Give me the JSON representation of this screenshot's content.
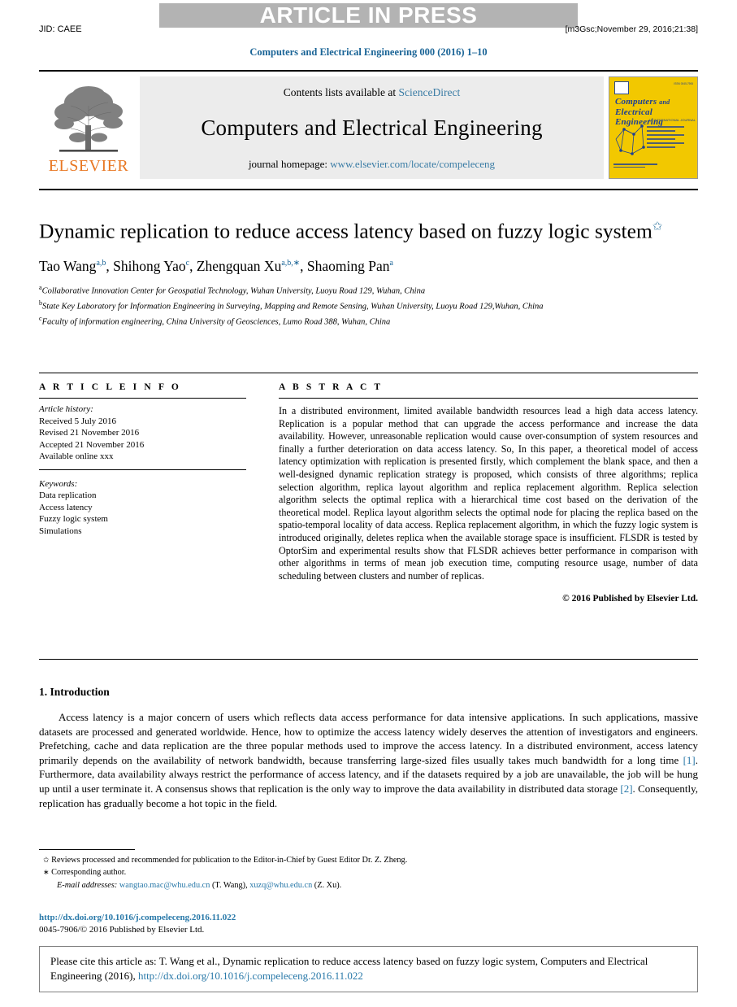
{
  "banner": {
    "text": "ARTICLE IN PRESS"
  },
  "header": {
    "jid": "JID: CAEE",
    "stamp": "[m3Gsc;November 29, 2016;21:38]",
    "running_title": "Computers and Electrical Engineering 000 (2016) 1–10"
  },
  "masthead": {
    "contents_prefix": "Contents lists available at ",
    "sciencedirect": "ScienceDirect",
    "journal_name": "Computers and Electrical Engineering",
    "homepage_prefix": "journal homepage: ",
    "homepage_url": "www.elsevier.com/locate/compeleceng",
    "publisher": "ELSEVIER",
    "cover": {
      "title_line1": "Computers",
      "title_line1b": "and",
      "title_line2": "Electrical Engineering",
      "sub": "AN INTERNATIONAL JOURNAL",
      "corner": "ISSN 0045-7906"
    }
  },
  "article": {
    "title": "Dynamic replication to reduce access latency based on fuzzy logic system",
    "title_star": "✩",
    "authors": [
      {
        "name": "Tao Wang",
        "sup": "a,b"
      },
      {
        "name": "Shihong Yao",
        "sup": "c"
      },
      {
        "name": "Zhengquan Xu",
        "sup": "a,b,∗"
      },
      {
        "name": "Shaoming Pan",
        "sup": "a"
      }
    ],
    "affiliations": [
      {
        "mark": "a",
        "text": "Collaborative Innovation Center for Geospatial Technology, Wuhan University, Luoyu Road 129, Wuhan, China"
      },
      {
        "mark": "b",
        "text": "State Key Laboratory for Information Engineering in Surveying, Mapping and Remote Sensing, Wuhan University, Luoyu Road 129,Wuhan, China"
      },
      {
        "mark": "c",
        "text": "Faculty of information engineering, China University of Geosciences, Lumo Road 388, Wuhan, China"
      }
    ]
  },
  "info": {
    "heading": "A R T I C L E   I N F O",
    "history_label": "Article history:",
    "history": [
      "Received 5 July 2016",
      "Revised 21 November 2016",
      "Accepted 21 November 2016",
      "Available online xxx"
    ],
    "keywords_label": "Keywords:",
    "keywords": [
      "Data replication",
      "Access latency",
      "Fuzzy logic system",
      "Simulations"
    ]
  },
  "abstract": {
    "heading": "A B S T R A C T",
    "text": "In a distributed environment, limited available bandwidth resources lead a high data access latency. Replication is a popular method that can upgrade the access performance and increase the data availability. However, unreasonable replication would cause over-consumption of system resources and finally a further deterioration on data access latency. So, In this paper, a theoretical model of access latency optimization with replication is presented firstly, which complement the blank space, and then a well-designed dynamic replication strategy is proposed, which consists of three algorithms; replica selection algorithm, replica layout algorithm and replica replacement algorithm. Replica selection algorithm selects the optimal replica with a hierarchical time cost based on the derivation of the theoretical model. Replica layout algorithm selects the optimal node for placing the replica based on the spatio-temporal locality of data access. Replica replacement algorithm, in which the fuzzy logic system is introduced originally, deletes replica when the available storage space is insufficient. FLSDR is tested by OptorSim and experimental results show that FLSDR achieves better performance in comparison with other algorithms in terms of mean job execution time, computing resource usage, number of data scheduling between clusters and number of replicas.",
    "copyright": "© 2016 Published by Elsevier Ltd."
  },
  "introduction": {
    "heading": "1. Introduction",
    "para_part1": "Access latency is a major concern of users which reflects data access performance for data intensive applications. In such applications, massive datasets are processed and generated worldwide. Hence, how to optimize the access latency widely deserves the attention of investigators and engineers. Prefetching, cache and data replication are the three popular methods used to improve the access latency. In a distributed environment, access latency primarily depends on the availability of network bandwidth, because transferring large-sized files usually takes much bandwidth for a long time ",
    "ref1": "[1]",
    "para_part2": ". Furthermore, data availability always restrict the performance of access latency, and if the datasets required by a job are unavailable, the job will be hung up until a user terminate it. A consensus shows that replication is the only way to improve the data availability in distributed data storage ",
    "ref2": "[2]",
    "para_part3": ". Consequently, replication has gradually become a hot topic in the field."
  },
  "footnotes": {
    "star_mark": "✩",
    "star_text": "Reviews processed and recommended for publication to the Editor-in-Chief by Guest Editor Dr. Z. Zheng.",
    "corr_mark": "∗",
    "corr_text": "Corresponding author.",
    "email_label": "E-mail addresses:",
    "email1": "wangtao.mac@whu.edu.cn",
    "email1_owner": "(T. Wang),",
    "email2": "xuzq@whu.edu.cn",
    "email2_owner": "(Z. Xu).",
    "doi": "http://dx.doi.org/10.1016/j.compeleceng.2016.11.022",
    "issn": "0045-7906/© 2016 Published by Elsevier Ltd."
  },
  "cite_box": {
    "text_before": "Please cite this article as: T. Wang et al., Dynamic replication to reduce access latency based on fuzzy logic system, Computers and Electrical Engineering (2016), ",
    "link": "http://dx.doi.org/10.1016/j.compeleceng.2016.11.022"
  },
  "colors": {
    "link_blue": "#2878a8",
    "banner_gray": "#b3b3b3",
    "elsevier_orange": "#e87722",
    "cover_yellow": "#f2c800",
    "cover_blue": "#1c3f94"
  }
}
